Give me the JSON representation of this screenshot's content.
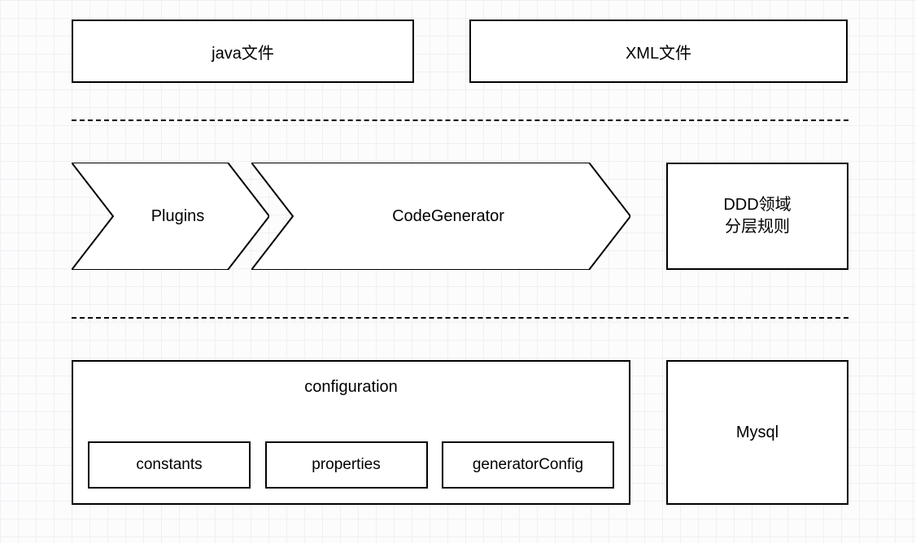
{
  "top": {
    "java_file": "java文件",
    "xml_file": "XML文件"
  },
  "middle": {
    "plugins": "Plugins",
    "code_generator": "CodeGenerator",
    "ddd_line1": "DDD领域",
    "ddd_line2": "分层规则"
  },
  "bottom": {
    "configuration": "configuration",
    "constants": "constants",
    "properties": "properties",
    "generator_config": "generatorConfig",
    "mysql": "Mysql"
  }
}
